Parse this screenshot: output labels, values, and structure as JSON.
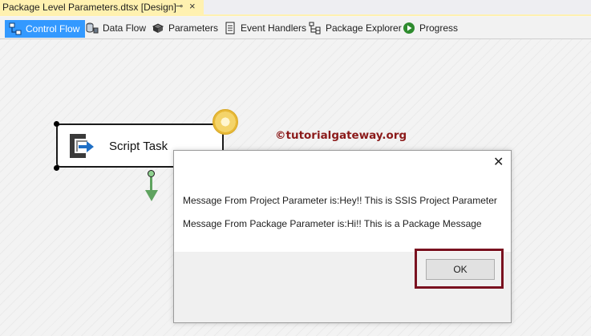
{
  "document_tab": {
    "title": "Package Level Parameters.dtsx [Design]",
    "pin_glyph": "⊸",
    "close_glyph": "×"
  },
  "designer_tabs": [
    {
      "label": "Control Flow",
      "icon": "control-flow-icon",
      "active": true
    },
    {
      "label": "Data Flow",
      "icon": "data-flow-icon",
      "active": false
    },
    {
      "label": "Parameters",
      "icon": "parameters-icon",
      "active": false
    },
    {
      "label": "Event Handlers",
      "icon": "event-handlers-icon",
      "active": false
    },
    {
      "label": "Package Explorer",
      "icon": "package-explorer-icon",
      "active": false
    },
    {
      "label": "Progress",
      "icon": "progress-icon",
      "active": false
    }
  ],
  "canvas": {
    "task": {
      "label": "Script Task",
      "icon": "script-task-icon"
    },
    "watermark": "©tutorialgateway.org"
  },
  "message_box": {
    "close_glyph": "✕",
    "line1": "Message From Project Parameter is:Hey!! This is SSIS Project Parameter",
    "line2": "Message From Package Parameter is:Hi!! This is a Package Message",
    "ok_label": "OK"
  },
  "colors": {
    "tab_active": "#3399ff",
    "doc_tab": "#fff1b0",
    "watermark": "#8b1a1a",
    "highlight": "#7a1220",
    "connector": "#5fa35f"
  }
}
